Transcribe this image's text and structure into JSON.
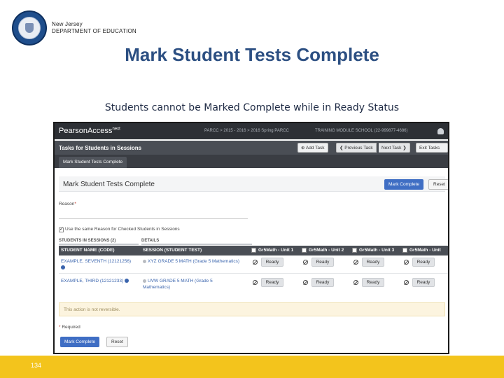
{
  "slide": {
    "org_line1": "New Jersey",
    "org_line2": "DEPARTMENT OF EDUCATION",
    "title": "Mark Student Tests Complete",
    "subtitle": "Students cannot be Marked Complete while in Ready Status",
    "page_number": "134"
  },
  "app": {
    "brand": "PearsonAccess",
    "brand_sup": "next",
    "breadcrumb": "PARCC > 2015 - 2016 > 2016 Spring PARCC",
    "organization": "TRAINING MODULE SCHOOL (22-999877-4686)",
    "taskbar_title": "Tasks for Students in Sessions",
    "add_task": "Add Task",
    "previous_task": "Previous Task",
    "next_task": "Next Task",
    "exit_tasks": "Exit Tasks",
    "tab_label": "Mark Student Tests Complete",
    "panel_title": "Mark Student Tests Complete",
    "mark_complete_top": "Mark Complete",
    "reset_top": "Reset",
    "reason_label": "Reason",
    "reason_star": "*",
    "reason_value": "",
    "use_same_label": "Use the same Reason for Checked Students in Sessions",
    "group_students": "STUDENTS IN SESSIONS (2)",
    "group_details": "DETAILS",
    "col_student": "STUDENT NAME (CODE)",
    "col_session": "SESSION (STUDENT TEST)",
    "units": [
      "Gr5Math - Unit 1",
      "Gr5Math - Unit 2",
      "Gr5Math - Unit 3",
      "Gr5Math - Unit"
    ],
    "rows": [
      {
        "student": "EXAMPLE, SEVENTH (12121256)",
        "session": "XYZ GRADE 5 MATH (Grade 5 Mathematics)",
        "statuses": [
          "Ready",
          "Ready",
          "Ready",
          "Ready"
        ]
      },
      {
        "student": "EXAMPLE, THIRD (12121233)",
        "session": "UVW GRADE 5 MATH (Grade 5",
        "session_cont": "Mathematics)",
        "statuses": [
          "Ready",
          "Ready",
          "Ready",
          "Ready"
        ]
      }
    ],
    "warning": "This action is not reversible.",
    "required_star": "*",
    "required_label": "Required",
    "mark_complete_bottom": "Mark Complete",
    "reset_bottom": "Reset"
  },
  "colors": {
    "title_blue": "#2c4f82",
    "primary_button": "#3f6ec4",
    "footer_yellow": "#f3c41c",
    "topbar": "#2d3035"
  }
}
